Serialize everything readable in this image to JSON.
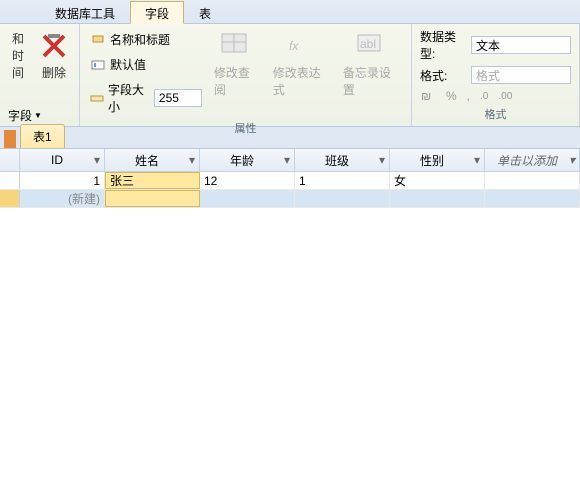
{
  "tabs": {
    "db_tools": "数据库工具",
    "fields": "字段",
    "table": "表"
  },
  "ribbon": {
    "left": {
      "date_time": "和时间",
      "field": "字段",
      "delete": "删除"
    },
    "name_title": "名称和标题",
    "default_value": "默认值",
    "field_size": "字段大小",
    "field_size_value": "255",
    "modify_query": "修改查阅",
    "modify_expr": "修改表达式",
    "memo_settings": "备忘录设置",
    "data_type_label": "数据类型:",
    "data_type_value": "文本",
    "format_label": "格式:",
    "format_placeholder": "格式",
    "currency": "%",
    "group_props": "属性",
    "group_format": "格式"
  },
  "sheet": {
    "tab": "表1"
  },
  "columns": {
    "id": "ID",
    "name": "姓名",
    "age": "年龄",
    "class": "班级",
    "sex": "性别",
    "add": "单击以添加"
  },
  "rows": [
    {
      "id": "1",
      "name": "张三",
      "age": "12",
      "class": "1",
      "sex": "女"
    }
  ],
  "new_row": "(新建)"
}
